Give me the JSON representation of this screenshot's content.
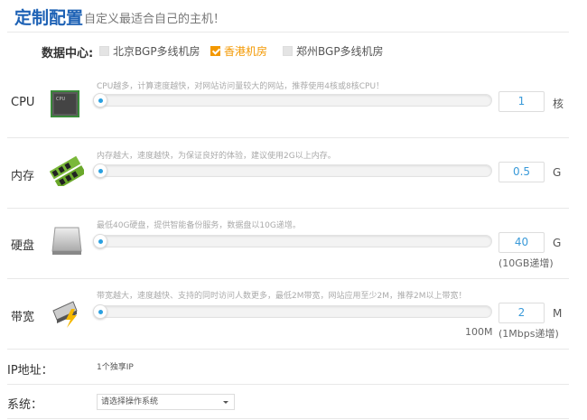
{
  "header": {
    "title": "定制配置",
    "subtitle": "自定义最适合自己的主机！"
  },
  "datacenter": {
    "label": "数据中心:",
    "options": [
      {
        "label": "北京BGP多线机房",
        "checked": false
      },
      {
        "label": "香港机房",
        "checked": true
      },
      {
        "label": "郑州BGP多线机房",
        "checked": false
      }
    ]
  },
  "rows": [
    {
      "label": "CPU",
      "icon": "cpu-chip-icon",
      "hint": "CPU越多，计算速度越快，对网站访问量较大的网站，推荐使用4核或8核CPU！",
      "value": "1",
      "unit": "核",
      "slider_fraction": 0
    },
    {
      "label": "内存",
      "icon": "memory-ram-icon",
      "hint": "内存越大，速度越快，为保证良好的体验，建议使用2G以上内存。",
      "value": "0.5",
      "unit": "G",
      "slider_fraction": 0
    },
    {
      "label": "硬盘",
      "icon": "hard-disk-icon",
      "hint": "最低40G硬盘，提供智能备份服务，数据盘以10G递增。",
      "value": "40",
      "unit": "G",
      "note": "(10GB递增)",
      "slider_fraction": 0
    },
    {
      "label": "带宽",
      "icon": "network-cable-icon",
      "hint": "带宽越大，速度越快、支持的同时访问人数更多，最低2M带宽，网站应用至少2M，推荐2M以上带宽！",
      "value": "2",
      "unit": "M",
      "max": "100M",
      "note": "(1Mbps递增)",
      "slider_fraction": 0
    }
  ],
  "ip": {
    "label": "IP地址：",
    "value": "1个独享IP"
  },
  "os": {
    "label": "系统：",
    "placeholder": "请选择操作系统"
  },
  "colors": {
    "title": "#1e62b5",
    "accent": "#f39800",
    "slider_dot": "#2aa0e0"
  }
}
